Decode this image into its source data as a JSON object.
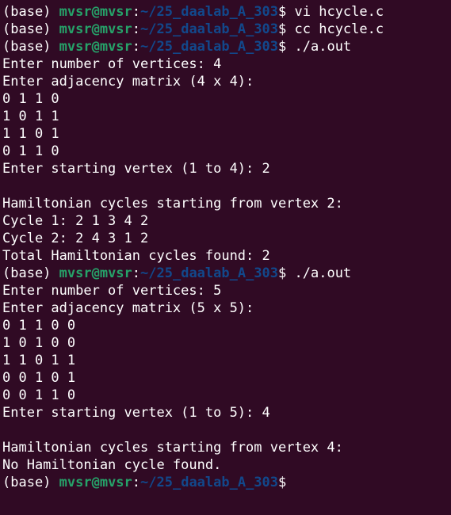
{
  "prompt": {
    "env": "(base) ",
    "user_host": "mvsr@mvsr",
    "colon": ":",
    "path": "~/25_daalab_A_303",
    "dollar": "$ "
  },
  "colors": {
    "background": "#300a24",
    "text": "#ffffff",
    "user_host": "#26a269",
    "path": "#12488b"
  },
  "lines": [
    {
      "type": "prompt",
      "command": "vi hcycle.c"
    },
    {
      "type": "prompt",
      "command": "cc hcycle.c"
    },
    {
      "type": "prompt",
      "command": "./a.out"
    },
    {
      "type": "out",
      "text": "Enter number of vertices: 4"
    },
    {
      "type": "out",
      "text": "Enter adjacency matrix (4 x 4):"
    },
    {
      "type": "out",
      "text": "0 1 1 0"
    },
    {
      "type": "out",
      "text": "1 0 1 1"
    },
    {
      "type": "out",
      "text": "1 1 0 1"
    },
    {
      "type": "out",
      "text": "0 1 1 0"
    },
    {
      "type": "out",
      "text": "Enter starting vertex (1 to 4): 2"
    },
    {
      "type": "out",
      "text": ""
    },
    {
      "type": "out",
      "text": "Hamiltonian cycles starting from vertex 2:"
    },
    {
      "type": "out",
      "text": "Cycle 1: 2 1 3 4 2"
    },
    {
      "type": "out",
      "text": "Cycle 2: 2 4 3 1 2"
    },
    {
      "type": "out",
      "text": "Total Hamiltonian cycles found: 2"
    },
    {
      "type": "prompt",
      "command": "./a.out"
    },
    {
      "type": "out",
      "text": "Enter number of vertices: 5"
    },
    {
      "type": "out",
      "text": "Enter adjacency matrix (5 x 5):"
    },
    {
      "type": "out",
      "text": "0 1 1 0 0"
    },
    {
      "type": "out",
      "text": "1 0 1 0 0"
    },
    {
      "type": "out",
      "text": "1 1 0 1 1"
    },
    {
      "type": "out",
      "text": "0 0 1 0 1"
    },
    {
      "type": "out",
      "text": "0 0 1 1 0"
    },
    {
      "type": "out",
      "text": "Enter starting vertex (1 to 5): 4"
    },
    {
      "type": "out",
      "text": ""
    },
    {
      "type": "out",
      "text": "Hamiltonian cycles starting from vertex 4:"
    },
    {
      "type": "out",
      "text": "No Hamiltonian cycle found."
    },
    {
      "type": "prompt",
      "command": ""
    }
  ]
}
